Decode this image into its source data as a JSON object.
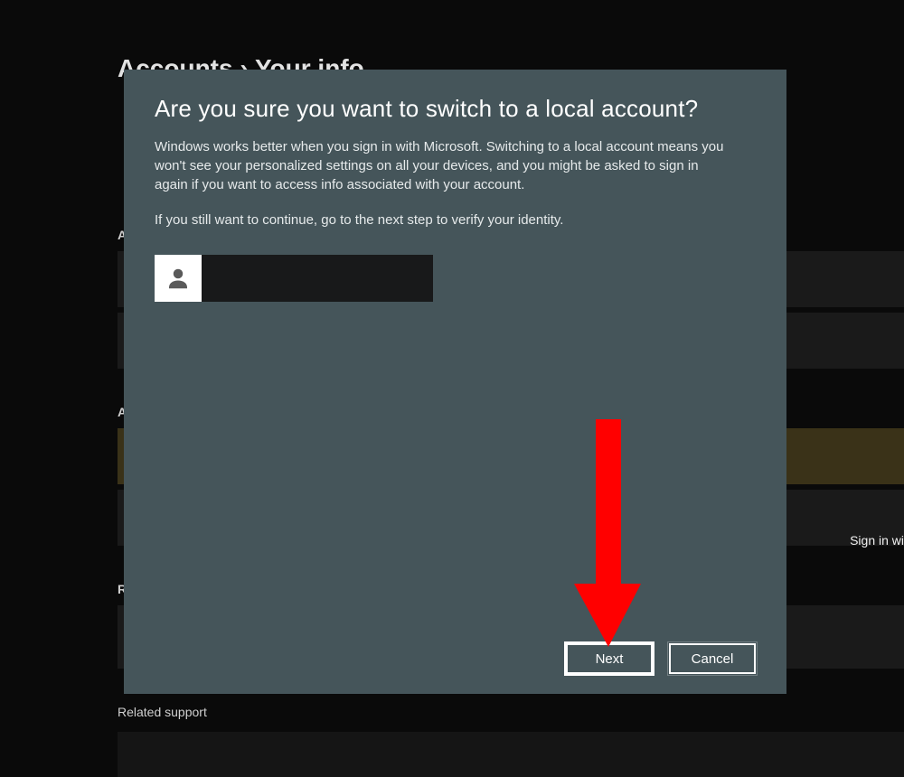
{
  "background": {
    "header": "Accounts › Your info",
    "sign_in_tile": "Sign in wi",
    "related_support": "Related support"
  },
  "modal": {
    "title": "Are you sure you want to switch to a local account?",
    "paragraph1": "Windows works better when you sign in with Microsoft. Switching to a local account means you won't see your personalized settings on all your devices, and you might be asked to sign in again if you want to access info associated with your account.",
    "paragraph2": "If you still want to continue, go to the next step to verify your identity.",
    "next_label": "Next",
    "cancel_label": "Cancel"
  },
  "annotation": {
    "arrow_color": "#ff0000"
  }
}
